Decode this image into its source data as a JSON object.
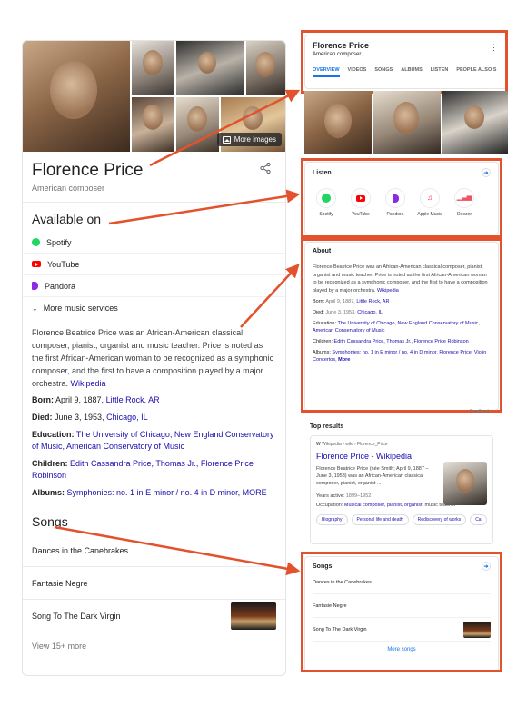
{
  "left_panel": {
    "more_images": "More images",
    "name": "Florence Price",
    "subtitle": "American composer",
    "available_on": "Available on",
    "services": [
      "Spotify",
      "YouTube",
      "Pandora"
    ],
    "more_services": "More music services",
    "about_text": "Florence Beatrice Price was an African-American classical composer, pianist, organist and music teacher. Price is noted as the first African-American woman to be recognized as a symphonic composer, and the first to have a composition played by a major orchestra.",
    "wikipedia": "Wikipedia",
    "born_label": "Born:",
    "born_date": "April 9, 1887,",
    "born_place": "Little Rock, AR",
    "died_label": "Died:",
    "died_date": "June 3, 1953,",
    "died_place": "Chicago, IL",
    "education_label": "Education:",
    "education_value": "The University of Chicago, New England Conservatory of Music, American Conservatory of Music",
    "children_label": "Children:",
    "children_value": "Edith Cassandra Price, Thomas Jr., Florence Price Robinson",
    "albums_label": "Albums:",
    "albums_value": "Symphonies: no. 1 in E minor / no. 4 in D minor, MORE",
    "songs_heading": "Songs",
    "songs": [
      "Dances in the Canebrakes",
      "Fantasie Negre",
      "Song To The Dark Virgin"
    ],
    "view_more": "View 15+ more"
  },
  "mobile": {
    "name": "Florence Price",
    "subtitle": "American composer",
    "kebab": "⋮",
    "tabs": [
      "OVERVIEW",
      "VIDEOS",
      "SONGS",
      "ALBUMS",
      "LISTEN",
      "PEOPLE ALSO S"
    ],
    "listen_heading": "Listen",
    "apps": [
      "Spotify",
      "YouTube",
      "Pandora",
      "Apple Music",
      "Deezer"
    ],
    "about_heading": "About",
    "about_text": "Florence Beatrice Price was an African-American classical composer, pianist, organist and music teacher. Price is noted as the first African-American woman to be recognized as a symphonic composer, and the first to have a composition played by a major orchestra.",
    "wikipedia": "Wikipedia",
    "born_label": "Born:",
    "born_date": "April 9, 1887,",
    "born_place": "Little Rock, AR",
    "died_label": "Died:",
    "died_date": "June 3, 1953,",
    "died_place": "Chicago, IL",
    "education_label": "Education:",
    "education_value": "The University of Chicago, New England Conservatory of Music, American Conservatory of Music",
    "children_label": "Children:",
    "children_value": "Edith Cassandra Price, Thomas Jr., Florence Price Robinson",
    "albums_label": "Albums:",
    "albums_value": "Symphonies: no. 1 in E minor / no. 4 in D minor, Florence Price: Violin Concertos,",
    "albums_more": "More",
    "feedback": "Feedback",
    "top_results_heading": "Top results",
    "result_source": "Wikipedia › wiki › Florence_Price",
    "result_title": "Florence Price - Wikipedia",
    "result_snippet": "Florence Beatrice Price (née Smith; April 9, 1887 – June 3, 1953) was an African-American classical composer, pianist, organist ...",
    "years_active_label": "Years active:",
    "years_active_value": "1899–1952",
    "occupation_label": "Occupation:",
    "occupation_value": "Musical composer, pianist, organist",
    "occupation_rest": "; music teacher",
    "chips": [
      "Biography",
      "Personal life and death",
      "Rediscovery of works",
      "Ca"
    ],
    "songs_heading": "Songs",
    "songs": [
      "Dances in the Canebrakes",
      "Fantasie Negre",
      "Song To The Dark Virgin"
    ],
    "more_songs": "More songs"
  },
  "colors": {
    "highlight": "#e2532d",
    "link": "#1a0dab",
    "accent": "#1a73e8"
  }
}
